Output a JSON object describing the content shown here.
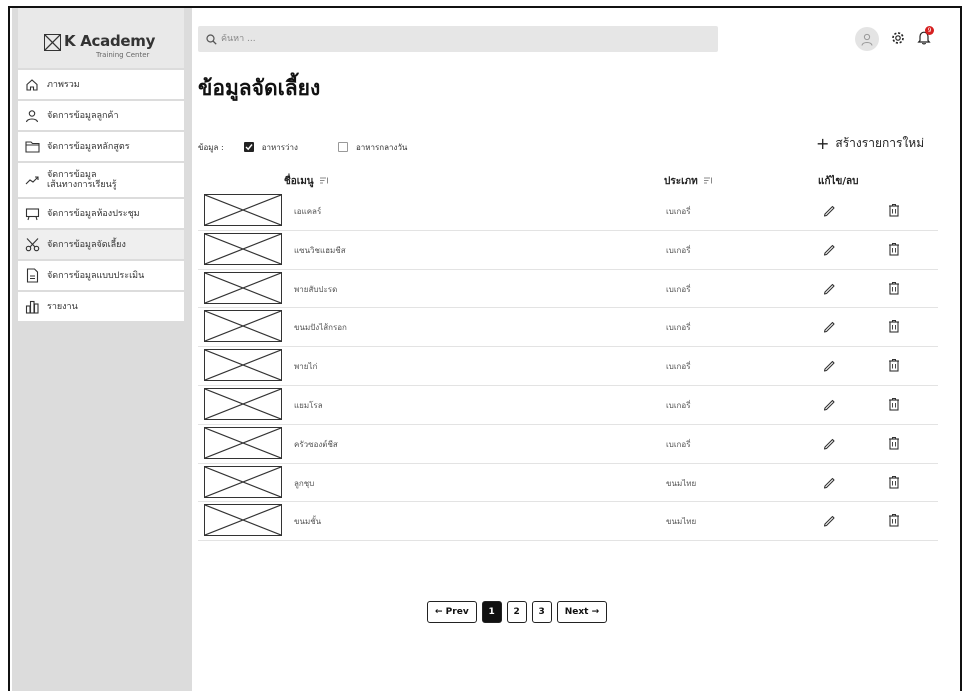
{
  "app": {
    "logo_text": "K Academy",
    "logo_sub": "Training Center"
  },
  "sidebar": {
    "items": [
      {
        "label": "ภาพรวม",
        "icon": "home-icon"
      },
      {
        "label": "จัดการข้อมูลลูกค้า",
        "icon": "user-icon"
      },
      {
        "label": "จัดการข้อมูลหลักสูตร",
        "icon": "folder-icon"
      },
      {
        "label": "จัดการข้อมูล\nเส้นทางการเรียนรู้",
        "icon": "trend-icon"
      },
      {
        "label": "จัดการข้อมูลห้องประชุม",
        "icon": "meeting-icon"
      },
      {
        "label": "จัดการข้อมูลจัดเลี้ยง",
        "icon": "scissors-icon",
        "active": true
      },
      {
        "label": "จัดการข้อมูลแบบประเมิน",
        "icon": "document-icon"
      },
      {
        "label": "รายงาน",
        "icon": "report-icon"
      }
    ]
  },
  "search": {
    "placeholder": "ค้นหา ..."
  },
  "notifications": {
    "count": "9"
  },
  "page": {
    "title": "ข้อมูลจัดเลี้ยง"
  },
  "filter": {
    "label": "ข้อมูล :",
    "options": [
      {
        "label": "อาหารว่าง",
        "checked": true
      },
      {
        "label": "อาหารกลางวัน",
        "checked": false
      }
    ]
  },
  "create_button": {
    "label": "สร้างรายการใหม่"
  },
  "table": {
    "headers": {
      "name": "ชื่อเมนู",
      "type": "ประเภท",
      "actions": "แก้ไข/ลบ"
    },
    "rows": [
      {
        "name": "เอแคลร์",
        "type": "เบเกอรี่"
      },
      {
        "name": "แซนวิชแฮมชีส",
        "type": "เบเกอรี่"
      },
      {
        "name": "พายสับปะรด",
        "type": "เบเกอรี่"
      },
      {
        "name": "ขนมปังไส้กรอก",
        "type": "เบเกอรี่"
      },
      {
        "name": "พายไก่",
        "type": "เบเกอรี่"
      },
      {
        "name": "แยมโรล",
        "type": "เบเกอรี่"
      },
      {
        "name": "ครัวซองต์ชีส",
        "type": "เบเกอรี่"
      },
      {
        "name": "ลูกชุบ",
        "type": "ขนมไทย"
      },
      {
        "name": "ขนมชั้น",
        "type": "ขนมไทย"
      }
    ]
  },
  "pagination": {
    "prev": "← Prev",
    "pages": [
      "1",
      "2",
      "3"
    ],
    "current": "1",
    "next": "Next →"
  }
}
